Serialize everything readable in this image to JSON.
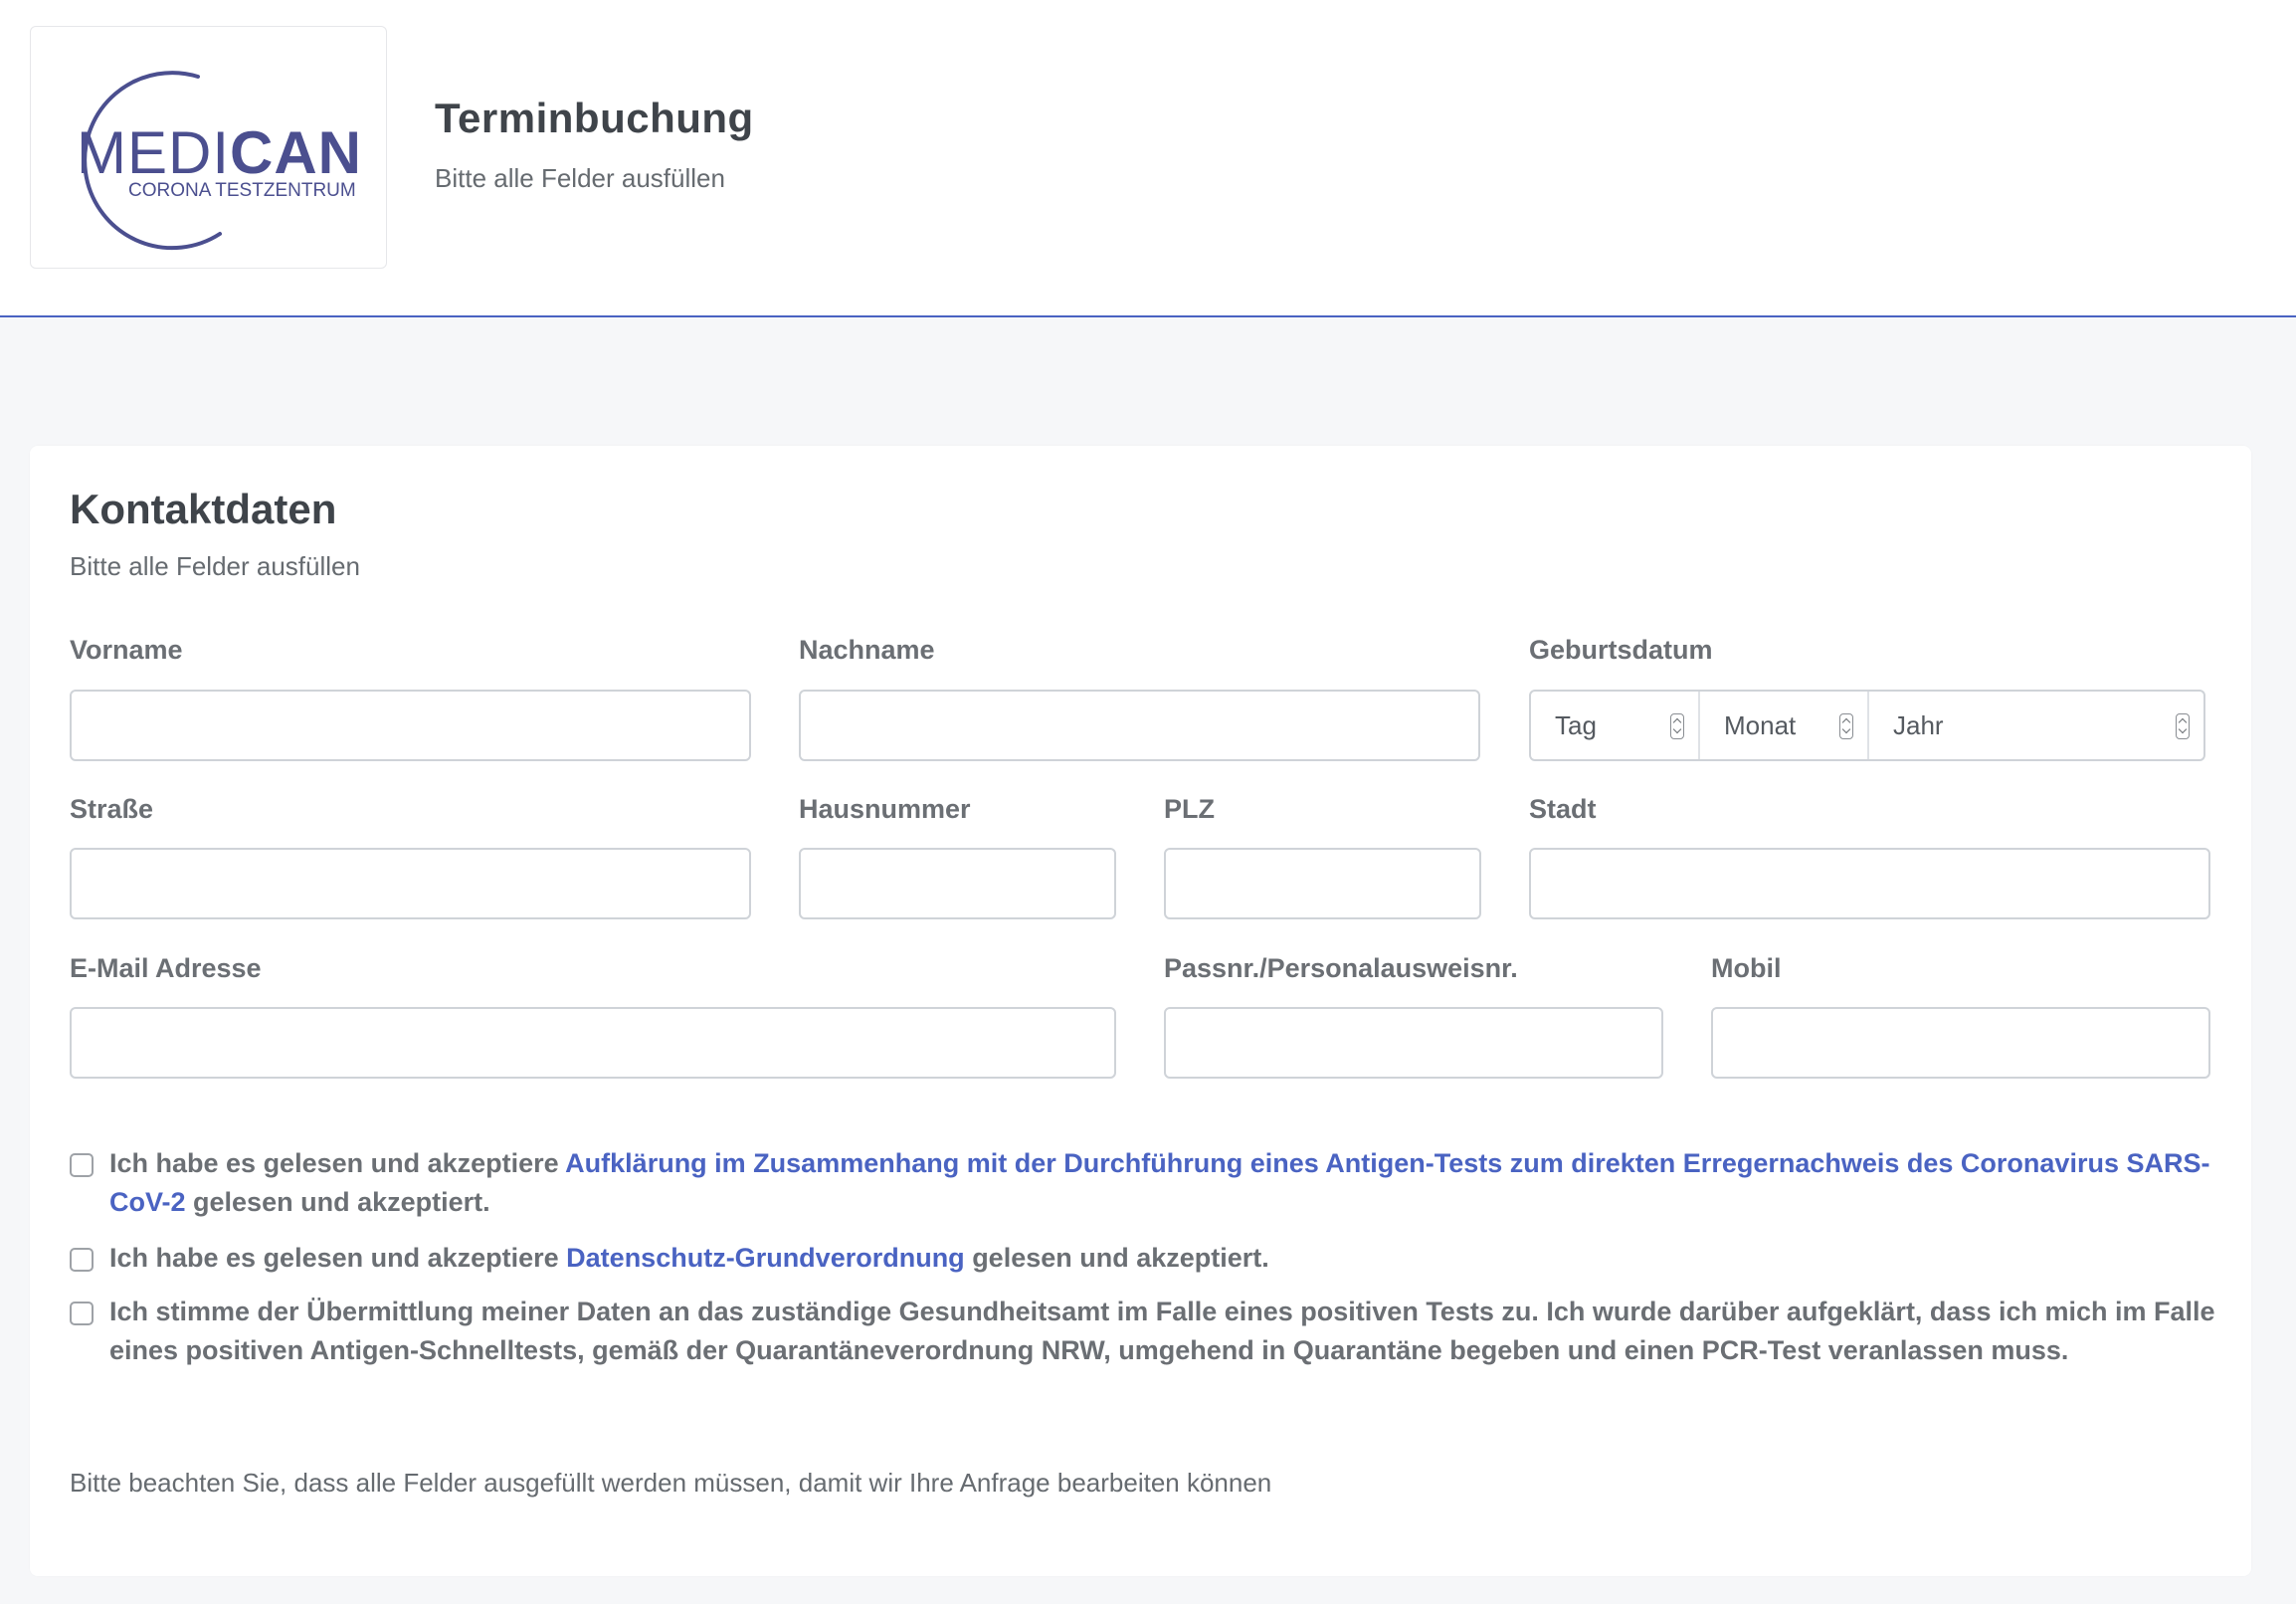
{
  "header": {
    "logo": {
      "brand_light": "MEDI",
      "brand_bold": "CAN",
      "tagline": "CORONA TESTZENTRUM"
    },
    "title": "Terminbuchung",
    "subtitle": "Bitte alle Felder ausfüllen"
  },
  "form": {
    "title": "Kontaktdaten",
    "subtitle": "Bitte alle Felder ausfüllen",
    "fields": {
      "vorname": {
        "label": "Vorname",
        "value": ""
      },
      "nachname": {
        "label": "Nachname",
        "value": ""
      },
      "geburtsdatum": {
        "label": "Geburtsdatum",
        "tag": "Tag",
        "monat": "Monat",
        "jahr": "Jahr"
      },
      "strasse": {
        "label": "Straße",
        "value": ""
      },
      "hausnummer": {
        "label": "Hausnummer",
        "value": ""
      },
      "plz": {
        "label": "PLZ",
        "value": ""
      },
      "stadt": {
        "label": "Stadt",
        "value": ""
      },
      "email": {
        "label": "E-Mail Adresse",
        "value": ""
      },
      "pass": {
        "label": "Passnr./Personalausweisnr.",
        "value": ""
      },
      "mobil": {
        "label": "Mobil",
        "value": ""
      }
    },
    "consents": [
      {
        "prefix": "Ich habe es gelesen und akzeptiere ",
        "link": "Aufklärung im Zusammenhang mit der Durchführung eines Antigen-Tests zum direkten Erregernachweis des Coronavirus SARS-CoV-2",
        "suffix": " gelesen und akzeptiert.",
        "checked": false
      },
      {
        "prefix": "Ich habe es gelesen und akzeptiere ",
        "link": "Datenschutz-Grundverordnung",
        "suffix": " gelesen und akzeptiert.",
        "checked": false
      },
      {
        "text": "Ich stimme der Übermittlung meiner Daten an das zuständige Gesundheitsamt im Falle eines positiven Tests zu. Ich wurde darüber aufgeklärt, dass ich mich im Falle eines positiven Antigen-Schnelltests, gemäß der Quarantäneverordnung NRW, umgehend in Quarantäne begeben und einen PCR-Test veranlassen muss.",
        "checked": false
      }
    ],
    "note": "Bitte beachten Sie, dass alle Felder ausgefüllt werden müssen, damit wir Ihre Anfrage bearbeiten können"
  },
  "colors": {
    "accent": "#4a63c2",
    "logo": "#4b4f8f",
    "text": "#6b6f74",
    "background": "#f6f7f9"
  }
}
